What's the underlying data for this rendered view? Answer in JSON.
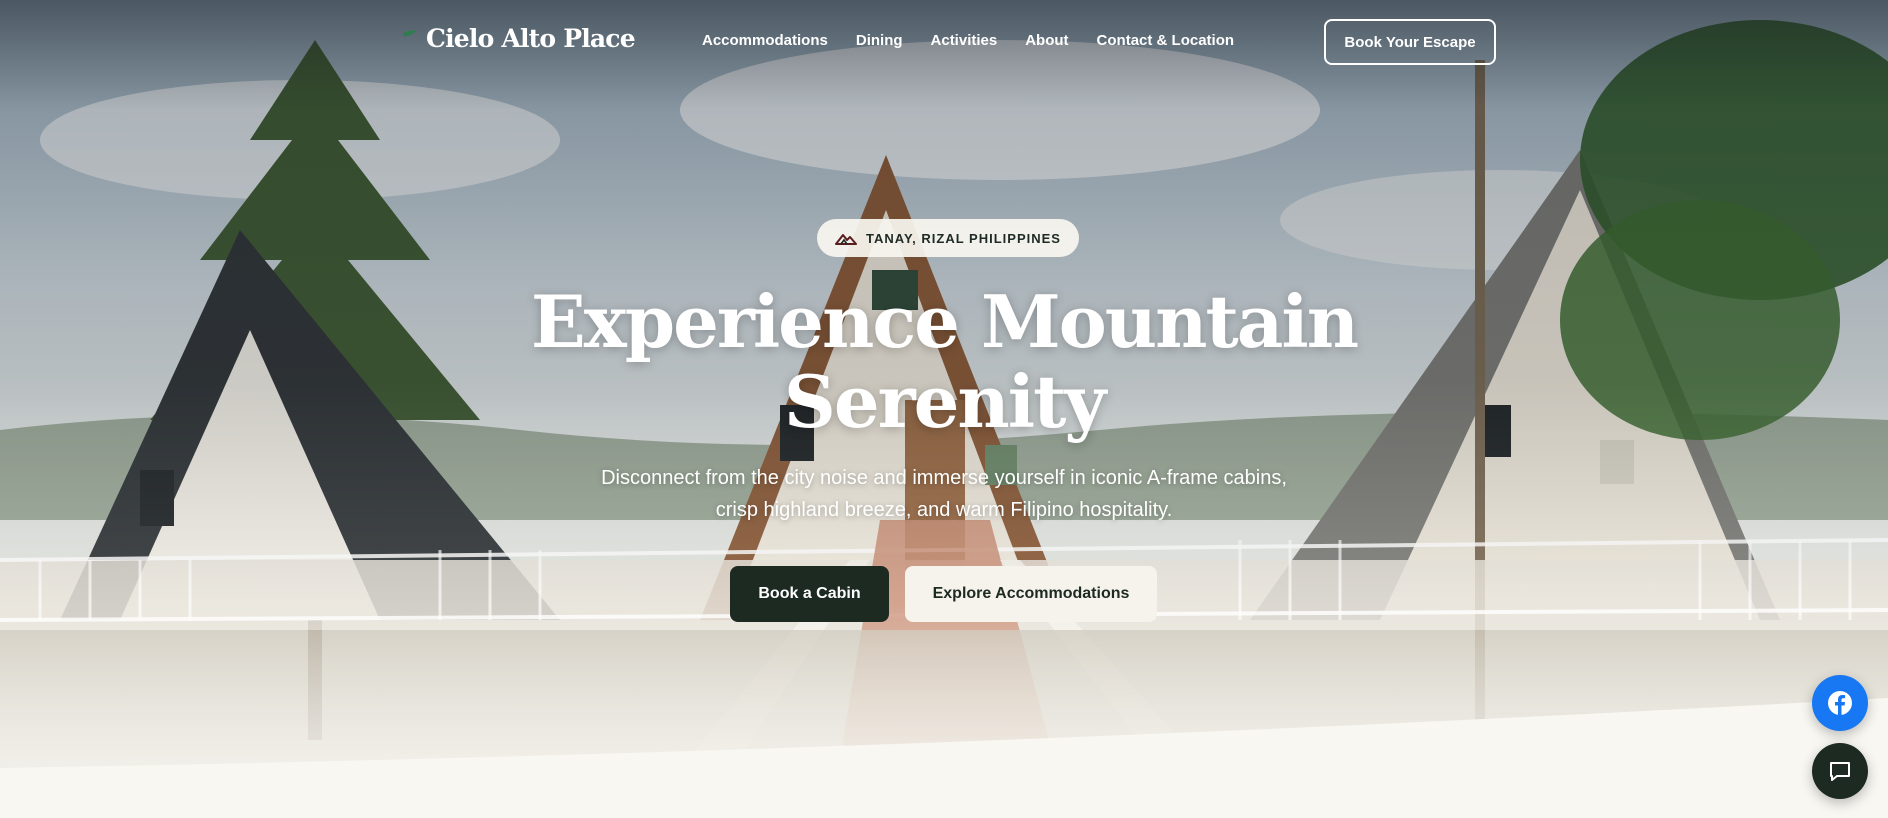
{
  "brand": {
    "name": "Cielo Alto Place",
    "logo_icon": "leaf-icon"
  },
  "nav": {
    "items": [
      {
        "label": "Accommodations"
      },
      {
        "label": "Dining"
      },
      {
        "label": "Activities"
      },
      {
        "label": "About"
      },
      {
        "label": "Contact & Location"
      }
    ],
    "cta_label": "Book Your Escape"
  },
  "hero": {
    "location_icon": "mountain-icon",
    "location": "TANAY, RIZAL PHILIPPINES",
    "title_line1": "Experience Mountain",
    "title_line2": "Serenity",
    "subtitle": "Disconnect from the city noise and immerse yourself in iconic A-frame cabins, crisp highland breeze, and warm Filipino hospitality.",
    "primary_button": "Book a Cabin",
    "secondary_button": "Explore Accommodations"
  },
  "floating": {
    "facebook_icon": "facebook-icon",
    "chat_icon": "chat-icon"
  },
  "colors": {
    "accent_dark": "#1c2a22",
    "facebook_blue": "#1877f2",
    "page_bg": "#f8f7f2"
  }
}
